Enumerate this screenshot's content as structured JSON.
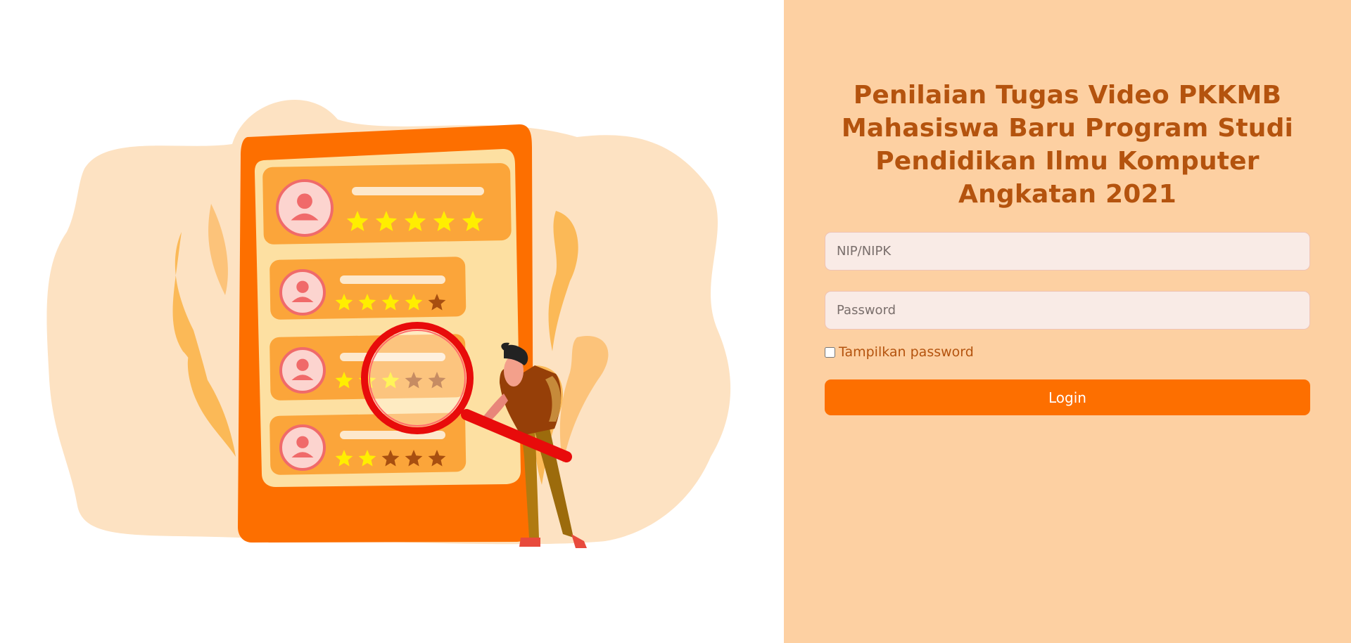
{
  "illustration": {
    "cards": [
      {
        "rating": 5,
        "of": 5
      },
      {
        "rating": 4,
        "of": 5
      },
      {
        "rating": 3,
        "of": 5
      },
      {
        "rating": 2,
        "of": 5
      }
    ]
  },
  "login": {
    "title": "Penilaian Tugas Video PKKMB Mahasiswa Baru Program Studi Pendidikan Ilmu Komputer Angkatan 2021",
    "nip_placeholder": "NIP/NIPK",
    "nip_value": "",
    "password_placeholder": "Password",
    "password_value": "",
    "show_password_label": "Tampilkan password",
    "show_password_checked": false,
    "login_label": "Login"
  },
  "colors": {
    "panel_bg": "#fdd0a2",
    "title": "#b4530e",
    "accent": "#fd6f00",
    "field_bg": "#f9ebe6",
    "star_on": "#ffee00",
    "star_off": "#a84f10"
  }
}
